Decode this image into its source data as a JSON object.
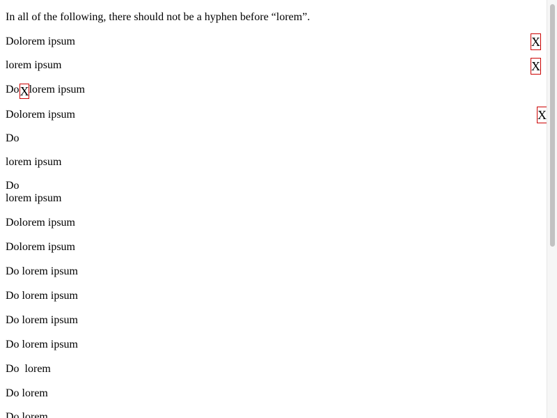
{
  "intro": "In all of the following, there should not be a hyphen before “lorem”.",
  "lines": [
    "Dolorem ipsum",
    "lorem ipsum",
    "Do",
    "lorem ipsum",
    "Dolorem ipsum",
    "Do",
    "lorem ipsum",
    "Do",
    "lorem ipsum",
    "Dolorem ipsum",
    "Dolorem ipsum",
    "Do lorem ipsum",
    "Do lorem ipsum",
    "Do lorem ipsum",
    "Do lorem ipsum",
    "Do  lorem",
    "Do lorem",
    "Do lorem"
  ],
  "markers": {
    "x1": "X",
    "x2": "X",
    "x3": "X",
    "x4": "X"
  }
}
